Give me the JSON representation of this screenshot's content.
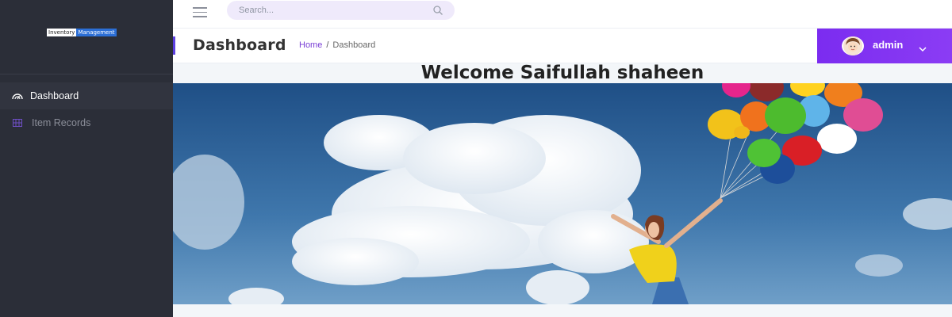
{
  "brand": {
    "logo_word1": "Inventory",
    "logo_word2": "Management"
  },
  "sidebar": {
    "items": [
      {
        "label": "Dashboard",
        "icon": "dashboard-gauge-icon",
        "active": true
      },
      {
        "label": "Item Records",
        "icon": "grid-table-icon",
        "active": false
      }
    ]
  },
  "topbar": {
    "search_placeholder": "Search...",
    "menu_icon": "hamburger-icon",
    "search_icon": "search-icon"
  },
  "header": {
    "title": "Dashboard",
    "breadcrumb": {
      "home": "Home",
      "separator": "/",
      "current": "Dashboard"
    },
    "user": {
      "name": "admin"
    }
  },
  "welcome": {
    "prefix": "Welcome ",
    "name": "Saifullah shaheen"
  },
  "colors": {
    "sidebar_bg": "#2b2e38",
    "accent": "#7b2cf0",
    "link": "#7a3fd6"
  }
}
